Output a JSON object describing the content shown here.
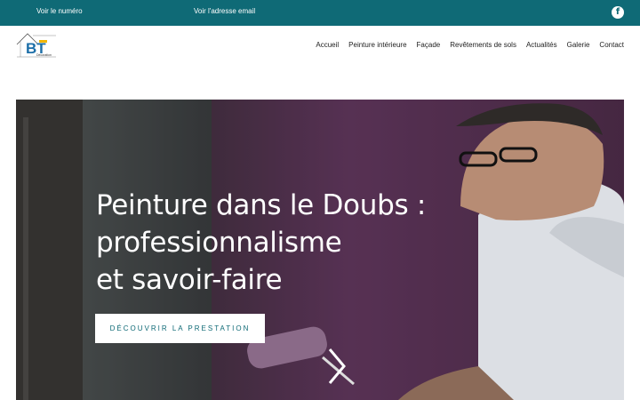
{
  "topbar": {
    "phone_label": "Voir le numéro",
    "email_label": "Voir l'adresse email",
    "facebook_glyph": "f",
    "background_color": "#0f6a76"
  },
  "header": {
    "logo_text": "BT",
    "logo_subtext": "Décoration",
    "nav": [
      {
        "label": "Accueil"
      },
      {
        "label": "Peinture intérieure"
      },
      {
        "label": "Façade"
      },
      {
        "label": "Revêtements de sols"
      },
      {
        "label": "Actualités"
      },
      {
        "label": "Galerie"
      },
      {
        "label": "Contact"
      }
    ]
  },
  "hero": {
    "title_lines": [
      "Peinture dans le Doubs :",
      "professionnalisme",
      "et savoir-faire"
    ],
    "cta_label": "DÉCOUVRIR LA PRESTATION",
    "next_icon": "chevron-right-icon"
  }
}
